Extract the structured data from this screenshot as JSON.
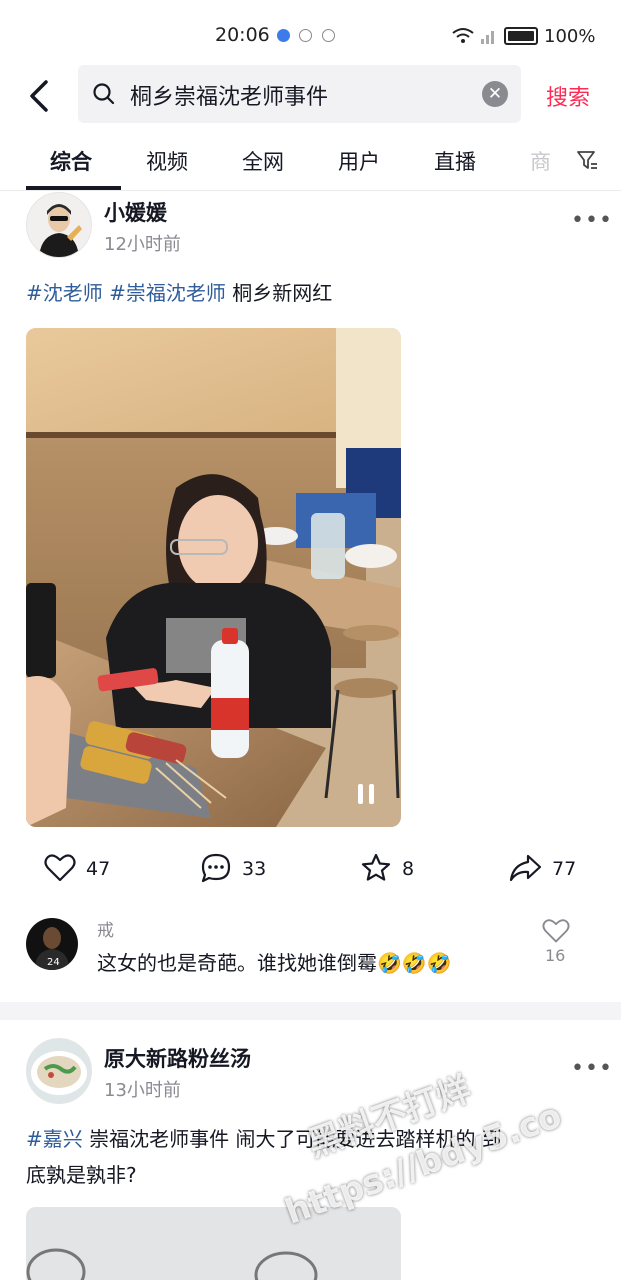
{
  "status": {
    "time": "20:06",
    "battery": "100%"
  },
  "search": {
    "query": "桐乡崇福沈老师事件",
    "button": "搜索"
  },
  "tabs": [
    "综合",
    "视频",
    "全网",
    "用户",
    "直播",
    "商"
  ],
  "posts": [
    {
      "author": "小媛媛",
      "time": "12小时前",
      "tags": [
        "#沈老师",
        "#崇福沈老师"
      ],
      "caption_rest": "桐乡新网红",
      "actions": {
        "like": "47",
        "comment": "33",
        "favorite": "8",
        "share": "77"
      },
      "top_comment": {
        "user": "戒",
        "text": "这女的也是奇葩。谁找她谁倒霉",
        "emoji": "🤣🤣🤣",
        "likes": "16"
      }
    },
    {
      "author": "原大新路粉丝汤",
      "time": "13小时前",
      "tag": "#嘉兴",
      "caption_line1": "崇福沈老师事件 闹大了可能要进去踏样机的 到",
      "caption_line2": "底孰是孰非?"
    }
  ],
  "watermark": {
    "line1": "黑料不打烊",
    "line2": "https://bdy5.co"
  },
  "colors": {
    "accent": "#fe2c55",
    "hashtag": "#2f5d9b",
    "secondary_text": "#8a8b91"
  }
}
